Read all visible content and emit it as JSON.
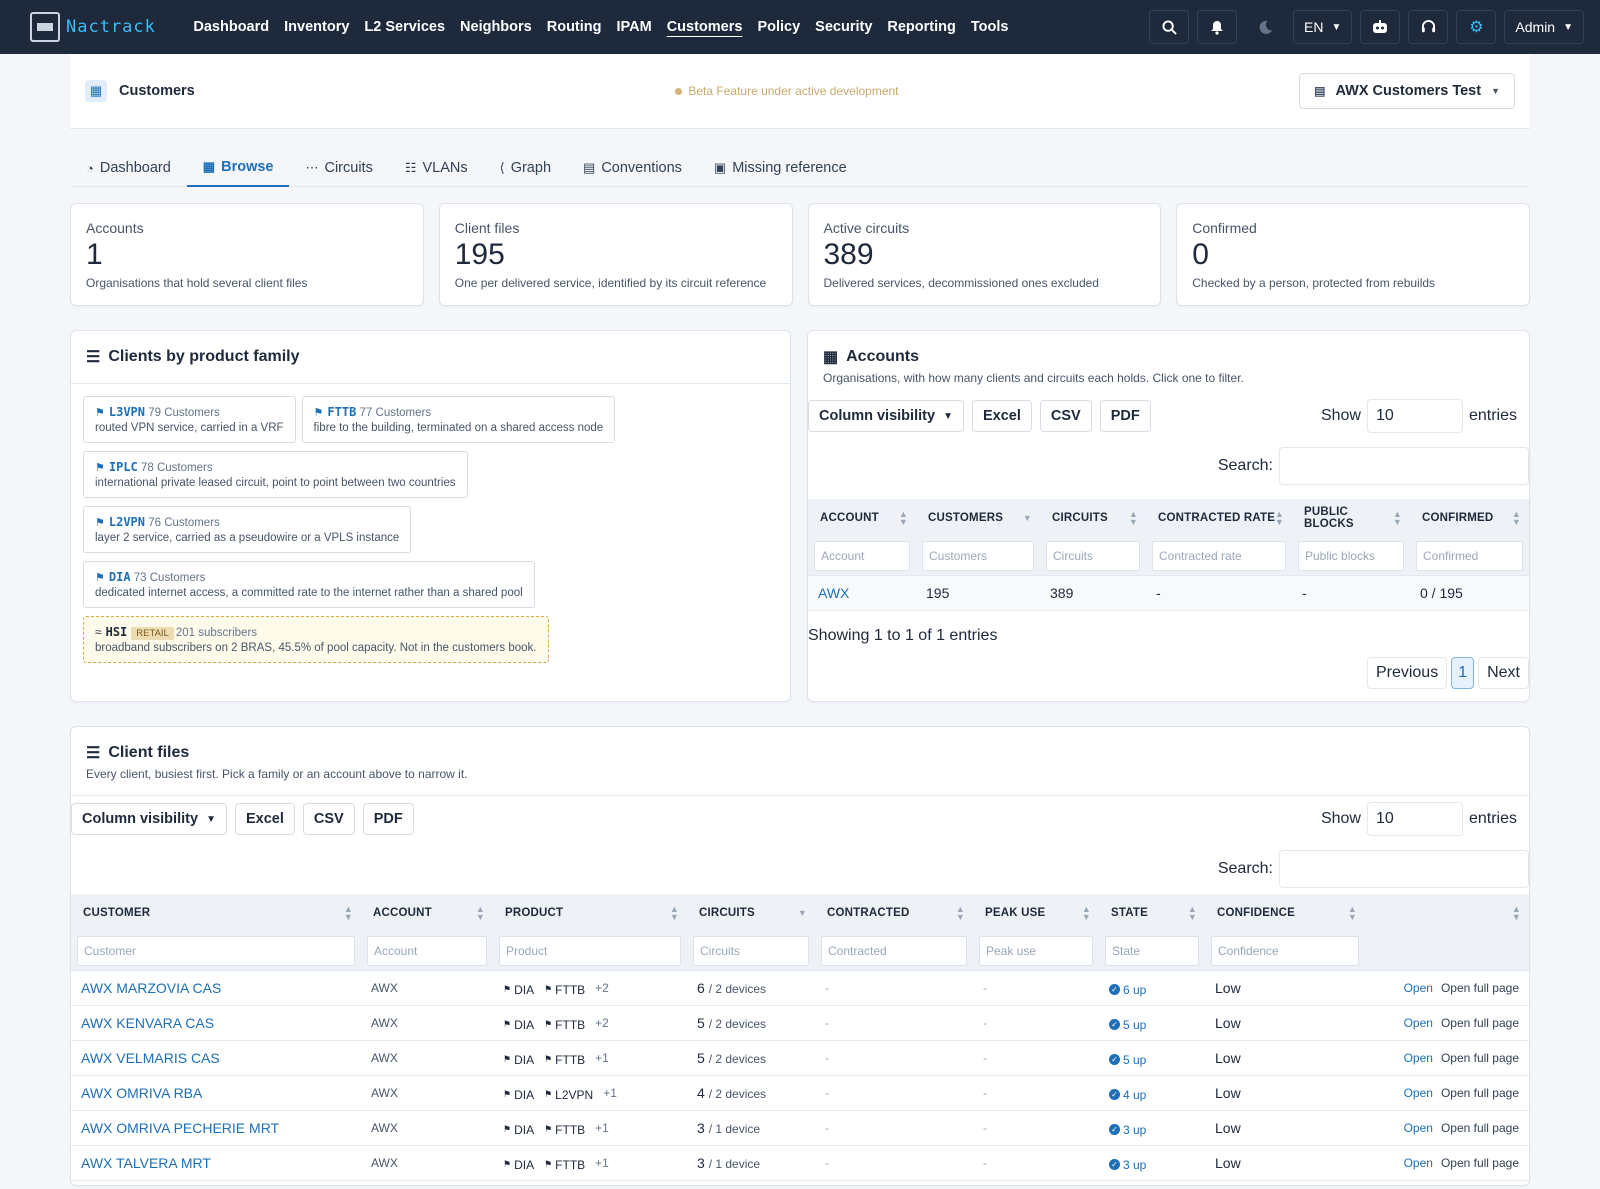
{
  "navbar": {
    "brand": "Nactrack",
    "items": [
      "Dashboard",
      "Inventory",
      "L2 Services",
      "Neighbors",
      "Routing",
      "IPAM",
      "Customers",
      "Policy",
      "Security",
      "Reporting",
      "Tools"
    ],
    "active": "Customers",
    "language": "EN",
    "user": "Admin"
  },
  "header": {
    "title": "Customers",
    "beta": "Beta Feature under active development",
    "tenant": "AWX Customers Test"
  },
  "tabs": [
    "Dashboard",
    "Browse",
    "Circuits",
    "VLANs",
    "Graph",
    "Conventions",
    "Missing reference"
  ],
  "active_tab": "Browse",
  "stats": [
    {
      "label": "Accounts",
      "value": "1",
      "sub": "Organisations that hold several client files"
    },
    {
      "label": "Client files",
      "value": "195",
      "sub": "One per delivered service, identified by its circuit reference"
    },
    {
      "label": "Active circuits",
      "value": "389",
      "sub": "Delivered services, decommissioned ones excluded"
    },
    {
      "label": "Confirmed",
      "value": "0",
      "sub": "Checked by a person, protected from rebuilds"
    }
  ],
  "families": {
    "title": "Clients by product family",
    "items": [
      {
        "code": "L3VPN",
        "count": "79 Customers",
        "desc": "routed VPN service, carried in a VRF"
      },
      {
        "code": "FTTB",
        "count": "77 Customers",
        "desc": "fibre to the building, terminated on a shared access node"
      },
      {
        "code": "IPLC",
        "count": "78 Customers",
        "desc": "international private leased circuit, point to point between two countries"
      },
      {
        "code": "L2VPN",
        "count": "76 Customers",
        "desc": "layer 2 service, carried as a pseudowire or a VPLS instance"
      },
      {
        "code": "DIA",
        "count": "73 Customers",
        "desc": "dedicated internet access, a committed rate to the internet rather than a shared pool"
      }
    ],
    "hsi": {
      "code": "HSI",
      "badge": "RETAIL",
      "count": "201 subscribers",
      "desc": "broadband subscribers on 2 BRAS, 45.5% of pool capacity. Not in the customers book."
    }
  },
  "accounts": {
    "title": "Accounts",
    "sub": "Organisations, with how many clients and circuits each holds. Click one to filter.",
    "buttons": {
      "colvis": "Column visibility",
      "excel": "Excel",
      "csv": "CSV",
      "pdf": "PDF"
    },
    "show_label": "Show",
    "show_value": "10",
    "entries_label": "entries",
    "search_label": "Search:",
    "columns": [
      {
        "label": "ACCOUNT",
        "filter": "Account"
      },
      {
        "label": "CUSTOMERS",
        "filter": "Customers"
      },
      {
        "label": "CIRCUITS",
        "filter": "Circuits"
      },
      {
        "label": "CONTRACTED RATE",
        "filter": "Contracted rate"
      },
      {
        "label": "PUBLIC BLOCKS",
        "filter": "Public blocks"
      },
      {
        "label": "CONFIRMED",
        "filter": "Confirmed"
      }
    ],
    "rows": [
      [
        "AWX",
        "195",
        "389",
        "-",
        "-",
        "0 / 195"
      ]
    ],
    "info": "Showing 1 to 1 of 1 entries",
    "prev": "Previous",
    "page": "1",
    "next": "Next"
  },
  "client_files": {
    "title": "Client files",
    "sub": "Every client, busiest first. Pick a family or an account above to narrow it.",
    "buttons": {
      "colvis": "Column visibility",
      "excel": "Excel",
      "csv": "CSV",
      "pdf": "PDF"
    },
    "show_label": "Show",
    "show_value": "10",
    "entries_label": "entries",
    "search_label": "Search:",
    "columns": [
      {
        "label": "CUSTOMER",
        "filter": "Customer"
      },
      {
        "label": "ACCOUNT",
        "filter": "Account"
      },
      {
        "label": "PRODUCT",
        "filter": "Product"
      },
      {
        "label": "CIRCUITS",
        "filter": "Circuits"
      },
      {
        "label": "CONTRACTED",
        "filter": "Contracted"
      },
      {
        "label": "PEAK USE",
        "filter": "Peak use"
      },
      {
        "label": "STATE",
        "filter": "State"
      },
      {
        "label": "CONFIDENCE",
        "filter": "Confidence"
      }
    ],
    "rows": [
      {
        "customer": "AWX MARZOVIA CAS",
        "account": "AWX",
        "p1": "DIA",
        "p2": "FTTB",
        "more": "+2",
        "circuits": "6",
        "devices": "/ 2 devices",
        "contracted": "-",
        "peak": "-",
        "state": "6 up",
        "confidence": "Low",
        "open": "Open",
        "full": "Open full page"
      },
      {
        "customer": "AWX KENVARA CAS",
        "account": "AWX",
        "p1": "DIA",
        "p2": "FTTB",
        "more": "+2",
        "circuits": "5",
        "devices": "/ 2 devices",
        "contracted": "-",
        "peak": "-",
        "state": "5 up",
        "confidence": "Low",
        "open": "Open",
        "full": "Open full page"
      },
      {
        "customer": "AWX VELMARIS CAS",
        "account": "AWX",
        "p1": "DIA",
        "p2": "FTTB",
        "more": "+1",
        "circuits": "5",
        "devices": "/ 2 devices",
        "contracted": "-",
        "peak": "-",
        "state": "5 up",
        "confidence": "Low",
        "open": "Open",
        "full": "Open full page"
      },
      {
        "customer": "AWX OMRIVA RBA",
        "account": "AWX",
        "p1": "DIA",
        "p2": "L2VPN",
        "more": "+1",
        "circuits": "4",
        "devices": "/ 2 devices",
        "contracted": "-",
        "peak": "-",
        "state": "4 up",
        "confidence": "Low",
        "open": "Open",
        "full": "Open full page"
      },
      {
        "customer": "AWX OMRIVA PECHERIE MRT",
        "account": "AWX",
        "p1": "DIA",
        "p2": "FTTB",
        "more": "+1",
        "circuits": "3",
        "devices": "/ 1 device",
        "contracted": "-",
        "peak": "-",
        "state": "3 up",
        "confidence": "Low",
        "open": "Open",
        "full": "Open full page"
      },
      {
        "customer": "AWX TALVERA MRT",
        "account": "AWX",
        "p1": "DIA",
        "p2": "FTTB",
        "more": "+1",
        "circuits": "3",
        "devices": "/ 1 device",
        "contracted": "-",
        "peak": "-",
        "state": "3 up",
        "confidence": "Low",
        "open": "Open",
        "full": "Open full page"
      }
    ]
  }
}
